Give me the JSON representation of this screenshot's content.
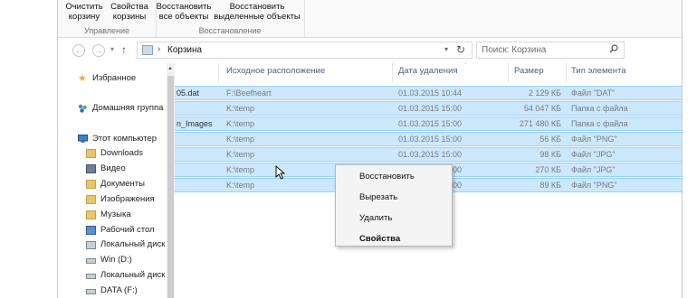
{
  "ribbon": {
    "groups": [
      {
        "label": "Управление",
        "buttons": [
          "Очистить корзину",
          "Свойства корзины"
        ]
      },
      {
        "label": "Восстановление",
        "buttons": [
          "Восстановить все объекты",
          "Восстановить выделенные объекты"
        ]
      }
    ],
    "buttons_lines": {
      "empty_bin": [
        "Очистить",
        "корзину"
      ],
      "bin_props": [
        "Свойства",
        "корзины"
      ],
      "restore_all": [
        "Восстановить",
        "все объекты"
      ],
      "restore_selected": [
        "Восстановить",
        "выделенные объекты"
      ]
    }
  },
  "address": {
    "crumb": "Корзина",
    "separator": "›",
    "search_placeholder": "Поиск: Корзина"
  },
  "nav": {
    "items": [
      {
        "label": "Избранное",
        "icon": "star-icon"
      },
      {
        "label": "Домашняя группа",
        "icon": "homegroup-icon"
      },
      {
        "label": "Этот компьютер",
        "icon": "computer-icon"
      },
      {
        "label": "Downloads",
        "icon": "folder-icon"
      },
      {
        "label": "Видео",
        "icon": "video-folder-icon"
      },
      {
        "label": "Документы",
        "icon": "documents-folder-icon"
      },
      {
        "label": "Изображения",
        "icon": "pictures-folder-icon"
      },
      {
        "label": "Музыка",
        "icon": "music-folder-icon"
      },
      {
        "label": "Рабочий стол",
        "icon": "desktop-folder-icon"
      },
      {
        "label": "Локальный диск",
        "icon": "drive-icon"
      },
      {
        "label": "Win (D:)",
        "icon": "drive-icon"
      },
      {
        "label": "Локальный диск",
        "icon": "drive-icon"
      },
      {
        "label": "DATA (F:)",
        "icon": "drive-icon"
      }
    ]
  },
  "columns": [
    "Исходное расположение",
    "Дата удаления",
    "Размер",
    "Тип элемента"
  ],
  "rows": [
    {
      "name": "05.dat",
      "location": "F:\\Beefheart",
      "date": "01.03.2015 10:44",
      "size": "2 129 КБ",
      "type": "Файл \"DAT\""
    },
    {
      "name": "",
      "location": "K:\\temp",
      "date": "01.03.2015 15:00",
      "size": "54 047 КБ",
      "type": "Папка с файла"
    },
    {
      "name": "n_Images",
      "location": "K:\\temp",
      "date": "01.03.2015 15:00",
      "size": "271 480 КБ",
      "type": "Папка с файла"
    },
    {
      "name": "",
      "location": "K:\\temp",
      "date": "01.03.2015 15:00",
      "size": "56 КБ",
      "type": "Файл \"PNG\""
    },
    {
      "name": "",
      "location": "K:\\temp",
      "date": "01.03.2015 15:00",
      "size": "98 КБ",
      "type": "Файл \"JPG\""
    },
    {
      "name": "",
      "location": "K:\\temp",
      "date": "01.03.2015 15:00",
      "size": "270 КБ",
      "type": "Файл \"JPG\""
    },
    {
      "name": "",
      "location": "K:\\temp",
      "date": "01.03.2015 15:00",
      "size": "89 КБ",
      "type": "Файл \"PNG\""
    }
  ],
  "context_menu": {
    "items": [
      "Восстановить",
      "Вырезать",
      "Удалить",
      "Свойства"
    ]
  },
  "colors": {
    "selection": "#cce8ff",
    "selection_border": "#99d1ff",
    "header_text": "#4d6082"
  }
}
